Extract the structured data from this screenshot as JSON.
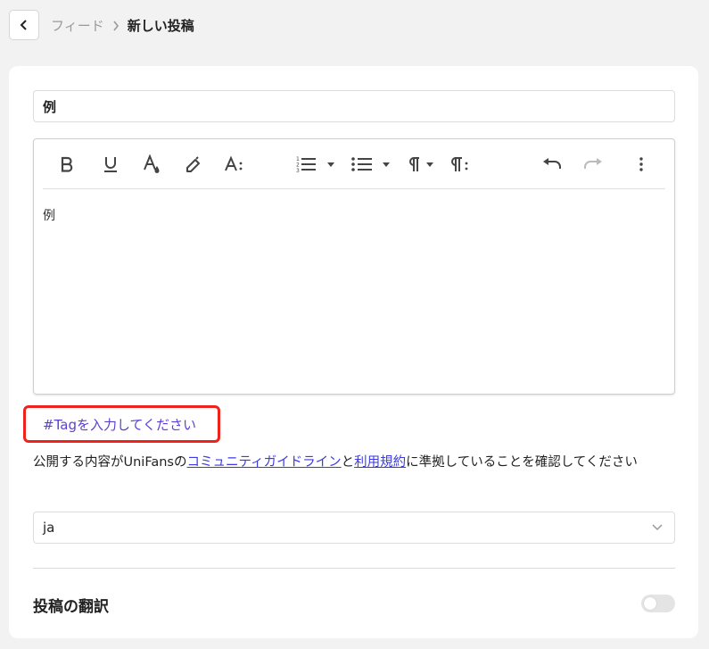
{
  "breadcrumb": {
    "parent": "フィード",
    "current": "新しい投稿"
  },
  "post": {
    "title_value": "例",
    "body_text": "例"
  },
  "toolbar": {
    "icons": [
      "bold-icon",
      "underline-icon",
      "text-color-icon",
      "highlight-icon",
      "font-size-icon",
      "ordered-list-icon",
      "bullet-list-icon",
      "paragraph-icon",
      "paragraph-format-icon",
      "undo-icon",
      "redo-icon",
      "more-icon"
    ]
  },
  "tag": {
    "placeholder": "#Tagを入力してください"
  },
  "terms": {
    "prefix": "公開する内容がUniFansの",
    "link1": "コミュニティガイドライン",
    "middle": "と",
    "link2": "利用規約",
    "suffix": "に準拠していることを確認してください"
  },
  "language": {
    "value": "ja"
  },
  "translation": {
    "label": "投稿の翻訳",
    "enabled": false
  },
  "colors": {
    "accent": "#5b3fd3",
    "link": "#3b3be0",
    "highlight_box": "#f0221c"
  }
}
